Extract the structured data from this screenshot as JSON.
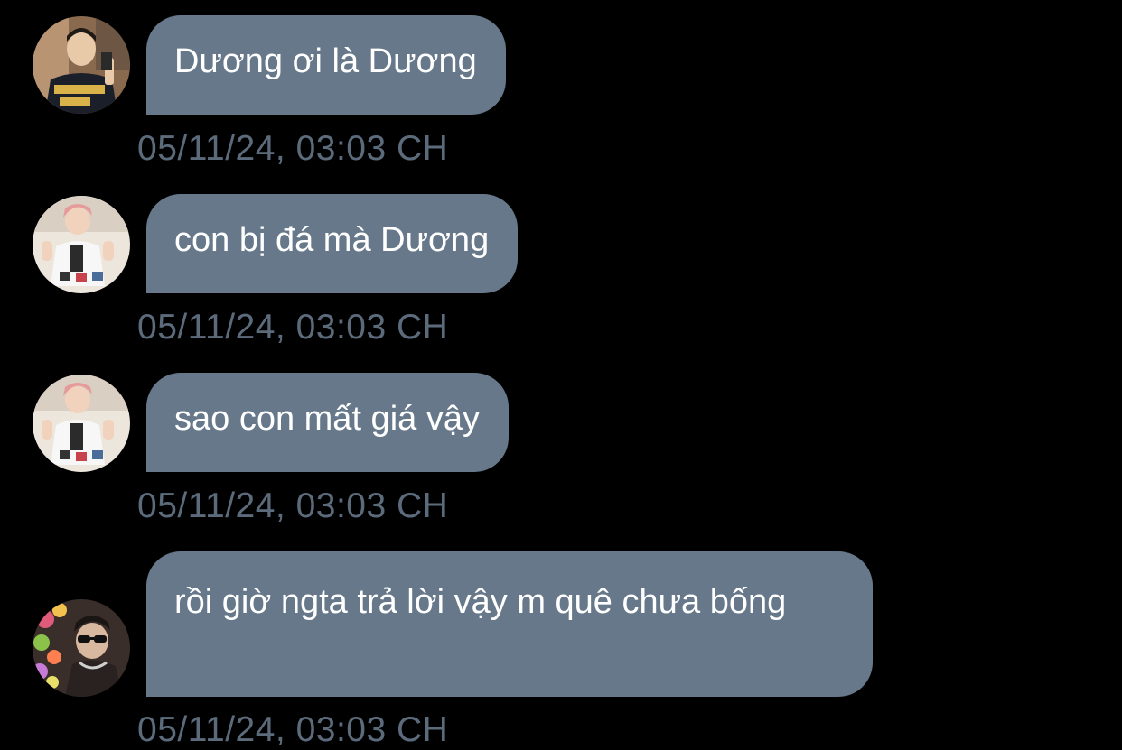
{
  "messages": [
    {
      "avatar_icon": "avatar-boy-black-shirt-icon",
      "text": "Dương ơi là Dương",
      "timestamp": "05/11/24, 03:03 CH"
    },
    {
      "avatar_icon": "avatar-pink-hair-white-suit-icon",
      "text": "con bị đá mà Dương",
      "timestamp": "05/11/24, 03:03 CH"
    },
    {
      "avatar_icon": "avatar-pink-hair-white-suit-icon",
      "text": "sao con mất giá vậy",
      "timestamp": "05/11/24, 03:03 CH"
    },
    {
      "avatar_icon": "avatar-sunglasses-flowers-icon",
      "text": "rồi giờ ngta trả lời vậy m quê chưa bống",
      "timestamp": "05/11/24, 03:03 CH"
    }
  ],
  "colors": {
    "background": "#000000",
    "bubble": "#66788a",
    "bubble_text": "#ffffff",
    "timestamp": "#5c6b7b"
  }
}
